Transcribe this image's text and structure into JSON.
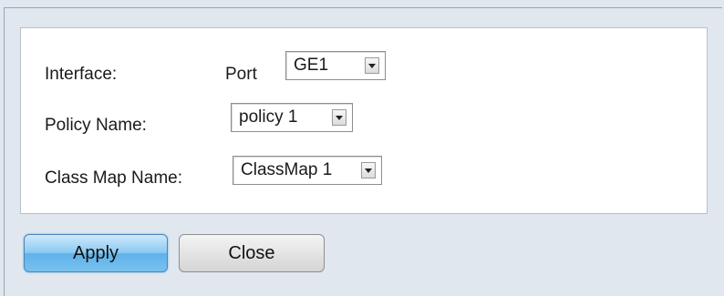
{
  "form": {
    "interface_label": "Interface:",
    "port_label": "Port",
    "port_value": "GE1",
    "policy_name_label": "Policy Name:",
    "policy_name_value": "policy 1",
    "class_map_name_label": "Class Map Name:",
    "class_map_name_value": "ClassMap 1"
  },
  "buttons": {
    "apply_label": "Apply",
    "close_label": "Close"
  },
  "colors": {
    "background": "#e1e7ee",
    "panel": "#ffffff",
    "apply_button": "#8ccaf1",
    "close_button": "#e4e4e4"
  }
}
